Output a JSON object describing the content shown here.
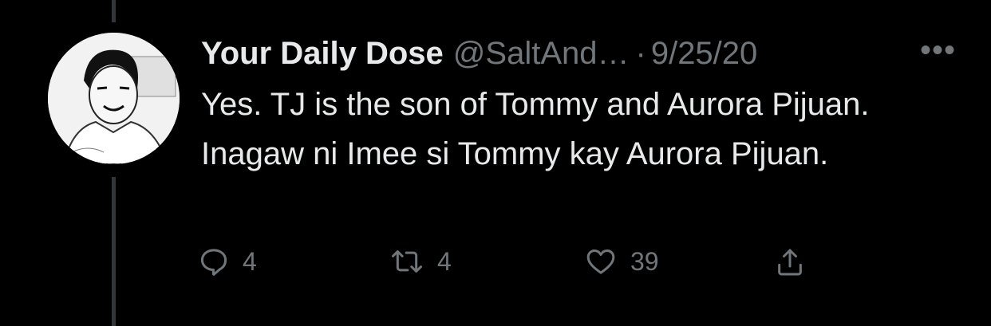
{
  "tweet": {
    "display_name": "Your Daily Dose",
    "handle": "@SaltAnd…",
    "separator": "·",
    "date": "9/25/20",
    "more_label": "•••",
    "text": "Yes. TJ is the son of Tommy and Aurora Pijuan. Inagaw ni Imee si Tommy kay Aurora Pijuan.",
    "avatar_icon": "profile-photo-icon"
  },
  "actions": {
    "reply": {
      "icon": "reply-icon",
      "count": "4"
    },
    "retweet": {
      "icon": "retweet-icon",
      "count": "4"
    },
    "like": {
      "icon": "heart-icon",
      "count": "39"
    },
    "share": {
      "icon": "share-icon"
    }
  },
  "colors": {
    "background": "#000000",
    "primary_text": "#e7e9ea",
    "secondary_text": "#71767b",
    "thread_line": "#333639"
  }
}
